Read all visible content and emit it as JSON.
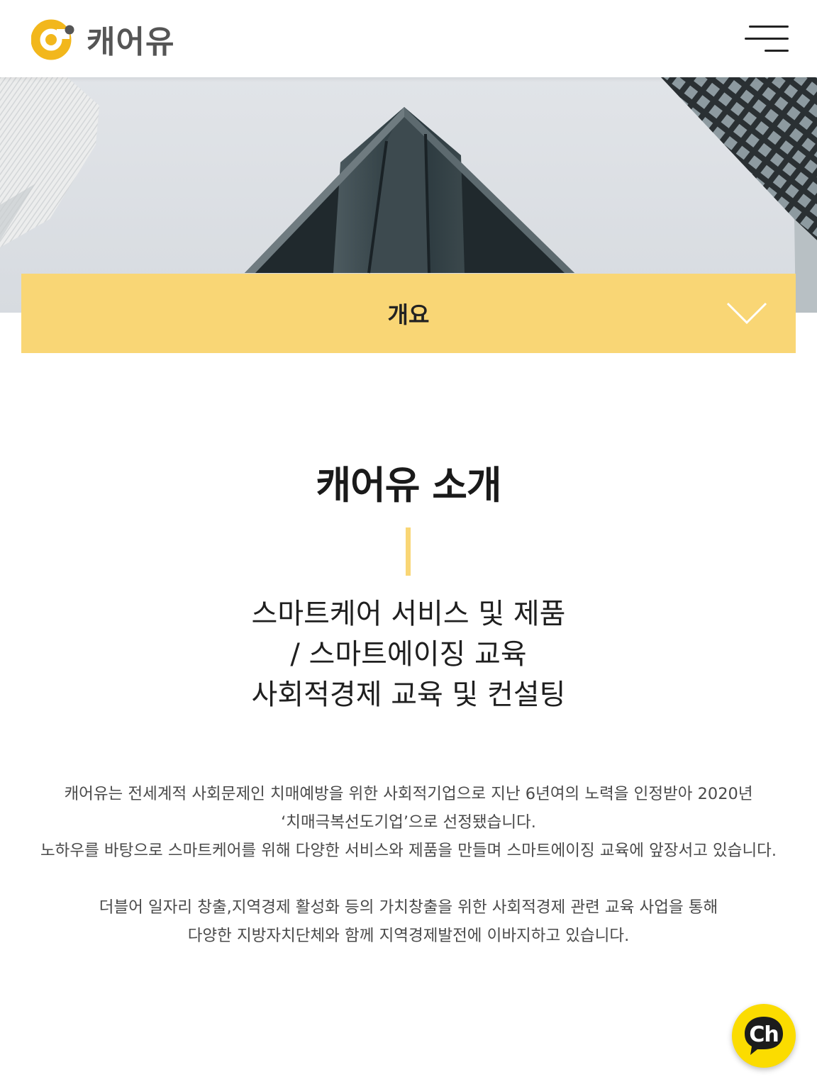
{
  "header": {
    "logo_text": "캐어유",
    "brand_color": "#f2b71c"
  },
  "hero": {
    "image": "skyscraper-looking-up"
  },
  "accordion": {
    "label": "개요",
    "icon": "chevron-down-icon",
    "color": "#f9d675"
  },
  "intro": {
    "title": "캐어유 소개",
    "subtitle_lines": [
      "스마트케어 서비스 및 제품",
      "/ 스마트에이징 교육",
      "사회적경제 교육 및 컨설팅"
    ],
    "paragraph1": [
      "캐어유는 전세계적 사회문제인 치매예방을 위한 사회적기업으로 지난 6년여의 노력을 인정받아 2020년",
      "‘치매극복선도기업’으로 선정됐습니다.",
      "노하우를 바탕으로 스마트케어를 위해 다양한 서비스와 제품을 만들며 스마트에이징 교육에 앞장서고 있습니다."
    ],
    "paragraph2": [
      "더블어 일자리 창출,지역경제 활성화 등의 가치창출을 위한 사회적경제 관련 교육 사업을 통해",
      "다양한 지방자치단체와 함께 지역경제발전에 이바지하고 있습니다."
    ]
  },
  "chat": {
    "label": "Ch",
    "color": "#fbdc00"
  }
}
